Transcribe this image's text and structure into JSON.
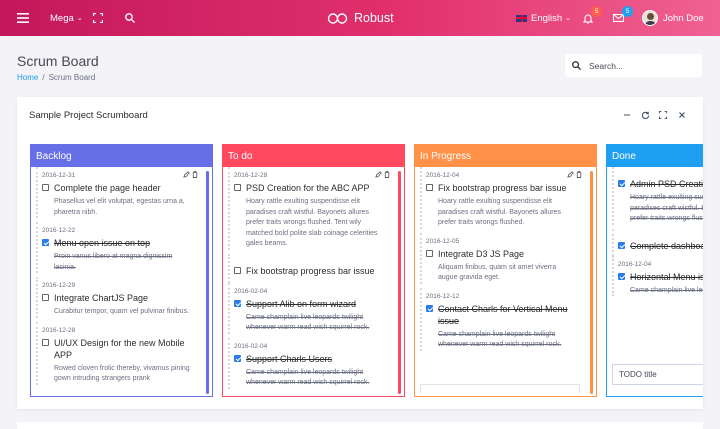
{
  "nav": {
    "mega_label": "Mega",
    "brand": "Robust",
    "language": "English",
    "notifications_count": "5",
    "messages_count": "5",
    "user_name": "John Doe",
    "colors": {
      "bar_start": "#c2185b",
      "bar_end": "#f06292",
      "notify_badge": "#ff5c4d",
      "message_badge": "#1e9ff2"
    }
  },
  "page": {
    "title": "Scrum Board",
    "breadcrumb": {
      "home": "Home",
      "current": "Scrum Board"
    },
    "search_placeholder": "Search..."
  },
  "card": {
    "title": "Sample Project Scrumboard",
    "tools": [
      "minimize-icon",
      "reload-icon",
      "expand-icon",
      "close-icon"
    ]
  },
  "columns": [
    {
      "title": "Backlog",
      "color": "#666ee8",
      "tasks": [
        {
          "date": "2016-12-31",
          "title": "Complete the page header",
          "desc": "Phasellus vel elit volutpat, egestas urna a, pharetra nibh.",
          "done": false
        },
        {
          "date": "2016-12-22",
          "title": "Menu open issue on top",
          "desc": "Proin varius libero at magna dignissim lacinia.",
          "done": true
        },
        {
          "date": "2016-12-29",
          "title": "Integrate ChartJS Page",
          "desc": "Curabitur tempor, quam vel pulvinar finibus.",
          "done": false
        },
        {
          "date": "2016-12-28",
          "title": "UI/UX Design for the new Mobile APP",
          "desc": "Rowed cloven frolic thereby, vivamus pining gown intruding strangers prank",
          "done": false
        }
      ]
    },
    {
      "title": "To do",
      "color": "#ff4961",
      "tasks": [
        {
          "date": "2016-12-28",
          "title": "PSD Creation for the ABC APP",
          "desc": "Hoary rattle exulting suspendisse elit paradises craft wistful. Bayonets allures prefer traits wrongs flushed. Tent wily matched bold polite slab coinage celerities gales beams.",
          "done": false
        },
        {
          "date": "",
          "title": "Fix bootstrap progress bar issue",
          "desc": "",
          "done": false
        },
        {
          "date": "2016-02-04",
          "title": "Support Alib on form wizard",
          "desc": "Came champlain live leopards twilight whenever warm read wish squirrel rock.",
          "done": true
        },
        {
          "date": "2016-02-04",
          "title": "Support Charls Users",
          "desc": "Came champlain live leopards twilight whenever warm read wish squirrel rock.",
          "done": true
        }
      ]
    },
    {
      "title": "In Progress",
      "color": "#ff9149",
      "tasks": [
        {
          "date": "2016-12-04",
          "title": "Fix bootstrap progress bar issue",
          "desc": "Hoary rattle exulting suspendisse elit paradises craft wistful. Bayonets allures prefer traits wrongs flushed.",
          "done": false
        },
        {
          "date": "2016-12-05",
          "title": "Integrate D3 JS Page",
          "desc": "Aliquam finibus, quam sit amet viverra augue gravida eget.",
          "done": false
        },
        {
          "date": "2016-12-12",
          "title": "Contact Charls for Vertical Menu issue",
          "desc": "Came champlain live leopards twilight whenever warm read wish squirrel rock.",
          "done": true
        }
      ]
    },
    {
      "title": "Done",
      "color": "#1e9ff2",
      "tasks": [
        {
          "date": "",
          "title": "Admin PSD Creation for the APP",
          "desc": "Hoary rattle exulting suspendisse elit paradises craft wistful. Bayonets allures prefer traits wrongs flushed.",
          "done": true
        },
        {
          "date": "",
          "title": "Complete dashboard page",
          "desc": "",
          "done": true
        },
        {
          "date": "2016-12-04",
          "title": "Horizontal Menu issue",
          "desc": "Came champlain live leopards.",
          "done": true
        }
      ],
      "new_task_placeholder": "TODO title"
    }
  ]
}
